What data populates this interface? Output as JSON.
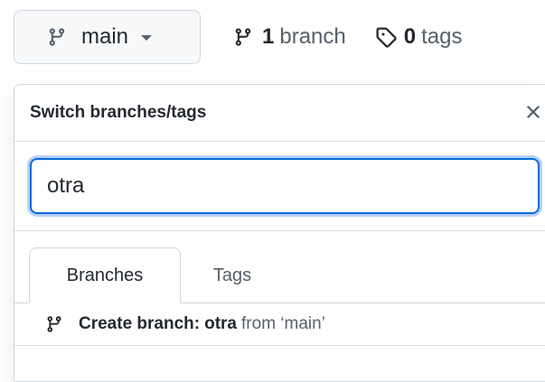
{
  "branch_select": {
    "current_branch": "main",
    "icon": "git-branch-icon"
  },
  "repo_meta": {
    "branches_count": "1",
    "branches_label": "branch",
    "tags_count": "0",
    "tags_label": "tags"
  },
  "dropdown": {
    "title": "Switch branches/tags",
    "close_icon": "close-icon",
    "filter_value": "otra",
    "tabs": [
      {
        "label": "Branches",
        "selected": true
      },
      {
        "label": "Tags",
        "selected": false
      }
    ],
    "create_row": {
      "label": "Create branch:",
      "name": "otra",
      "from_text": "from ‘main’"
    }
  },
  "colors": {
    "accent": "#0969da",
    "text": "#24292f",
    "muted": "#57606a",
    "border": "#d0d7de"
  }
}
